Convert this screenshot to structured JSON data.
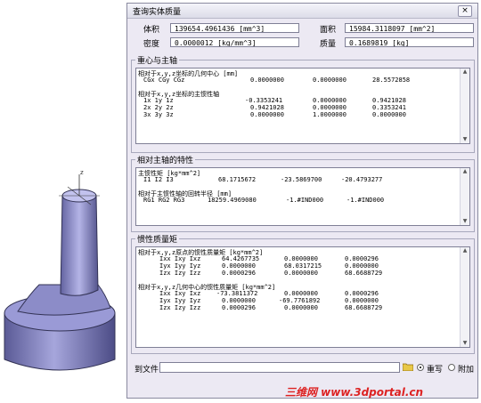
{
  "dialog": {
    "title": "查询实体质量",
    "close_label": "×"
  },
  "props": {
    "volume_label": "体积",
    "volume_value": "139654.4961436 [mm^3]",
    "area_label": "面积",
    "area_value": "15984.3118097 [mm^2]",
    "density_label": "密度",
    "density_value": "0.0000012 [kg/mm^3]",
    "mass_label": "质量",
    "mass_value": "0.1689819 [kg]"
  },
  "centroid": {
    "title": "重心与主轴",
    "line1": "相对于x,y,z坐标的几何中心 [mm]",
    "cog": [
      "CGx CGy CGz",
      "0.0000000",
      "0.0000000",
      "28.5572858"
    ],
    "line2": "相对于x,y,z坐标的主惯性轴",
    "axes": [
      [
        "1x  1y  1z",
        "-0.3353241",
        "0.0000000",
        "0.9421028"
      ],
      [
        "2x  2y  2z",
        "0.9421028",
        "0.0000000",
        "0.3353241"
      ],
      [
        "3x  3y  3z",
        "0.0000000",
        "1.0000000",
        "0.0000000"
      ]
    ]
  },
  "principal": {
    "title": "相对主轴的特性",
    "line1": "主惯性矩 [kg*mm^2]",
    "moments": [
      "I1  I2  I3",
      "68.1715672",
      "-23.5869700",
      "-20.4793277"
    ],
    "line2": "相对于主惯性轴的回转半径 [mm]",
    "radii": [
      "RG1 RG2 RG3",
      "18259.4969080",
      "-1.#IND000",
      "-1.#IND000"
    ]
  },
  "inertia": {
    "title": "惯性质量矩",
    "line1": "相对于x,y,z原点的惯性质量矩 [kg*mm^2]",
    "origin": [
      [
        "Ixx Ixy Ixz",
        "64.4267735",
        "0.0000000",
        "0.0000296"
      ],
      [
        "Iyx Iyy Iyz",
        "0.0000000",
        "68.0317215",
        "0.0000000"
      ],
      [
        "Izx Izy Izz",
        "0.0000296",
        "0.0000000",
        "68.6688729"
      ]
    ],
    "line2": "相对于x,y,z几何中心的惯性质量矩 [kg*mm^2]",
    "center": [
      [
        "Ixx Ixy Ixz",
        "-73.3811372",
        "0.0000000",
        "0.0000296"
      ],
      [
        "Iyx Iyy Iyz",
        "0.0000000",
        "-69.7761892",
        "0.0000000"
      ],
      [
        "Izx Izy Izz",
        "0.0000296",
        "0.0000000",
        "68.6688729"
      ]
    ]
  },
  "footer": {
    "file_label": "到文件",
    "file_value": "",
    "overwrite_label": "重写",
    "append_label": "附加"
  },
  "watermark": "三维网 www.3dportal.cn"
}
